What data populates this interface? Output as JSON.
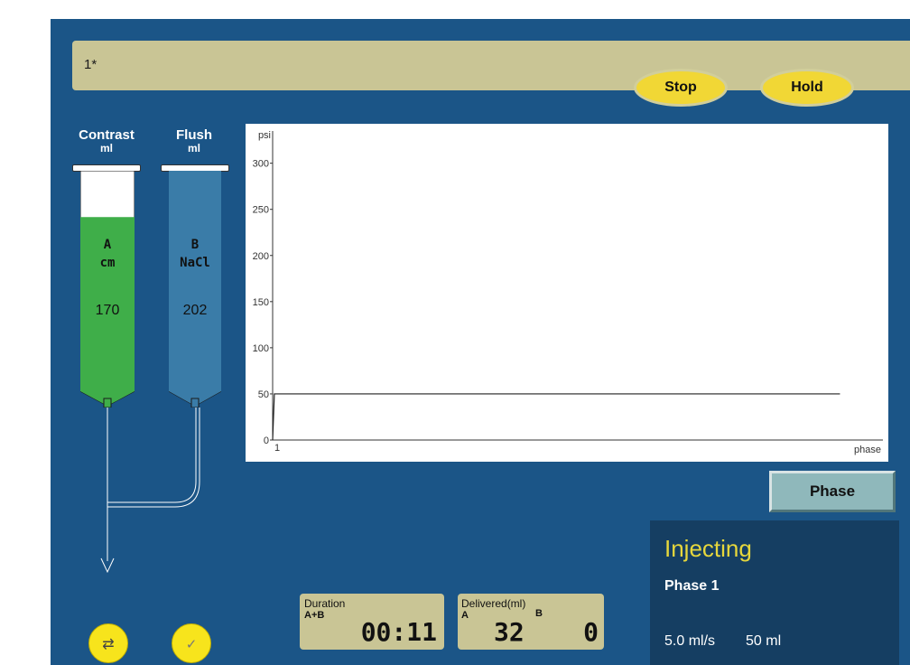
{
  "status_bar": {
    "text": "1*"
  },
  "controls": {
    "stop_label": "Stop",
    "hold_label": "Hold",
    "phase_label": "Phase"
  },
  "syringe_a": {
    "header": "Contrast",
    "unit": "ml",
    "letter": "A",
    "name": "cm",
    "volume": "170",
    "color": "#3fae49",
    "fill_level": 0.79
  },
  "syringe_b": {
    "header": "Flush",
    "unit": "ml",
    "letter": "B",
    "name": "NaCl",
    "volume": "202",
    "color": "#3a7ca8",
    "fill_level": 1.0
  },
  "chart_data": {
    "type": "line",
    "ylabel": "psi",
    "xlabel": "phase",
    "x_tick_labels": [
      "1"
    ],
    "yticks": [
      0,
      50,
      100,
      150,
      200,
      250,
      300
    ],
    "ylim": [
      0,
      330
    ],
    "xlim": [
      0,
      1
    ],
    "series": [
      {
        "x": [
          0.0,
          0.003,
          0.985
        ],
        "y": [
          0,
          50,
          50
        ]
      }
    ],
    "grid": false
  },
  "injection": {
    "title": "Injecting",
    "phase": "Phase 1",
    "rate": "5.0 ml/s",
    "volume": "50 ml"
  },
  "duration": {
    "label": "Duration",
    "sub_label": "A+B",
    "value": "00:11"
  },
  "delivered": {
    "label": "Delivered(ml)",
    "a_label": "A",
    "a_value": "32",
    "b_label": "B",
    "b_value": "0"
  },
  "buttons": {
    "swap_icon": "swap-arrows-icon",
    "confirm_icon": "check-icon"
  },
  "colors": {
    "panel": "#1b5587",
    "accent_yellow": "#f1d735",
    "status_bg": "#c9c595",
    "inject_title": "#e6d73c"
  }
}
